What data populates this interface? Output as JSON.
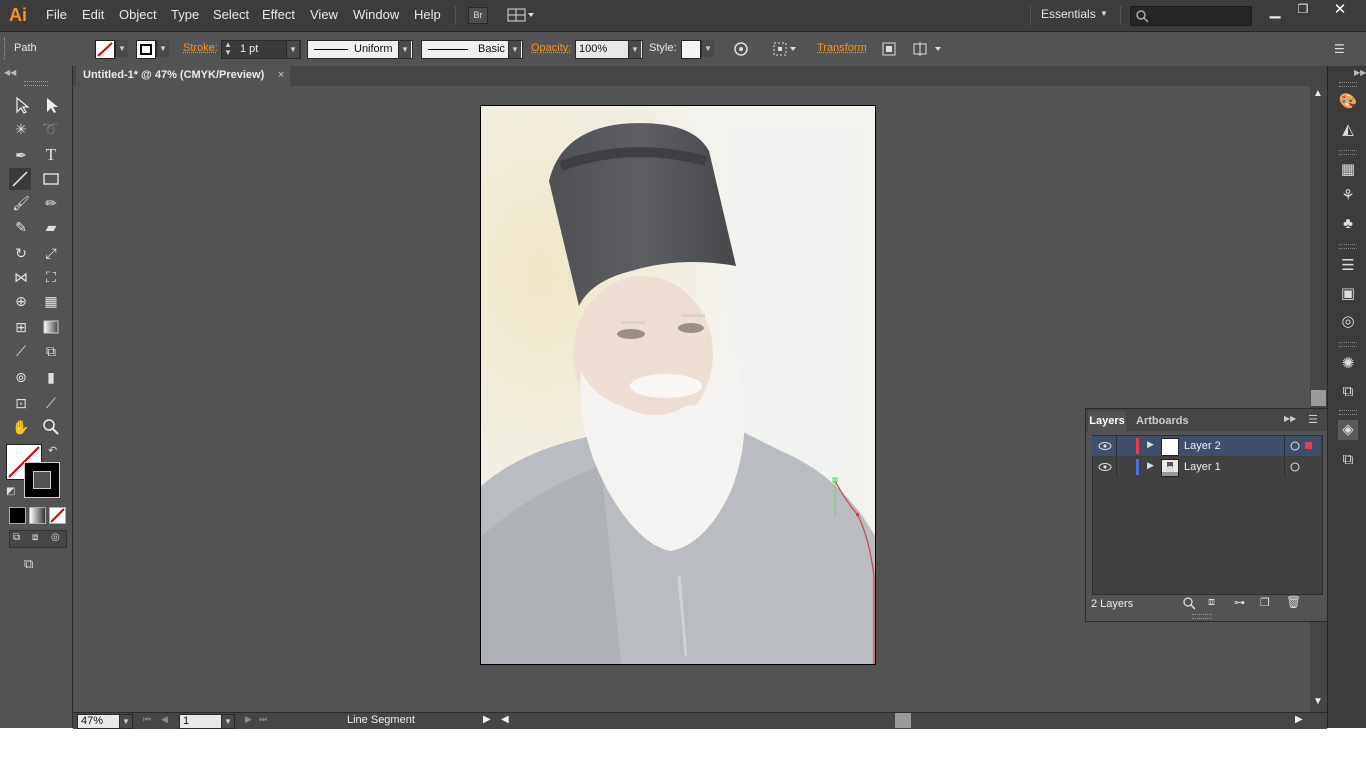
{
  "app": {
    "logo": "Ai",
    "menus": [
      "File",
      "Edit",
      "Object",
      "Type",
      "Select",
      "Effect",
      "View",
      "Window",
      "Help"
    ],
    "bridge_label": "Br",
    "workspace": "Essentials",
    "search_placeholder": ""
  },
  "control_bar": {
    "selection_type": "Path",
    "stroke_label": "Stroke:",
    "stroke_weight": "1 pt",
    "variable_width": "Uniform",
    "brush": "Basic",
    "opacity_label": "Opacity:",
    "opacity_value": "100%",
    "style_label": "Style:",
    "transform_label": "Transform"
  },
  "document": {
    "tab_title": "Untitled-1* @ 47% (CMYK/Preview)",
    "artboard_image": "portrait-photo-elderly-bearded-man"
  },
  "status_bar": {
    "zoom": "47%",
    "artboard_number": "1",
    "current_tool": "Line Segment"
  },
  "layers_panel": {
    "tabs": [
      "Layers",
      "Artboards"
    ],
    "layers": [
      {
        "name": "Layer 2",
        "color": "#e04040",
        "selected": true
      },
      {
        "name": "Layer 1",
        "color": "#4f6fe0",
        "selected": false
      }
    ],
    "count_label": "2 Layers"
  },
  "colors": {
    "accent": "#f7931e",
    "panel_bg": "#535353",
    "dark_bar": "#3c3c3c",
    "selection_blue": "#3f4f6b"
  }
}
